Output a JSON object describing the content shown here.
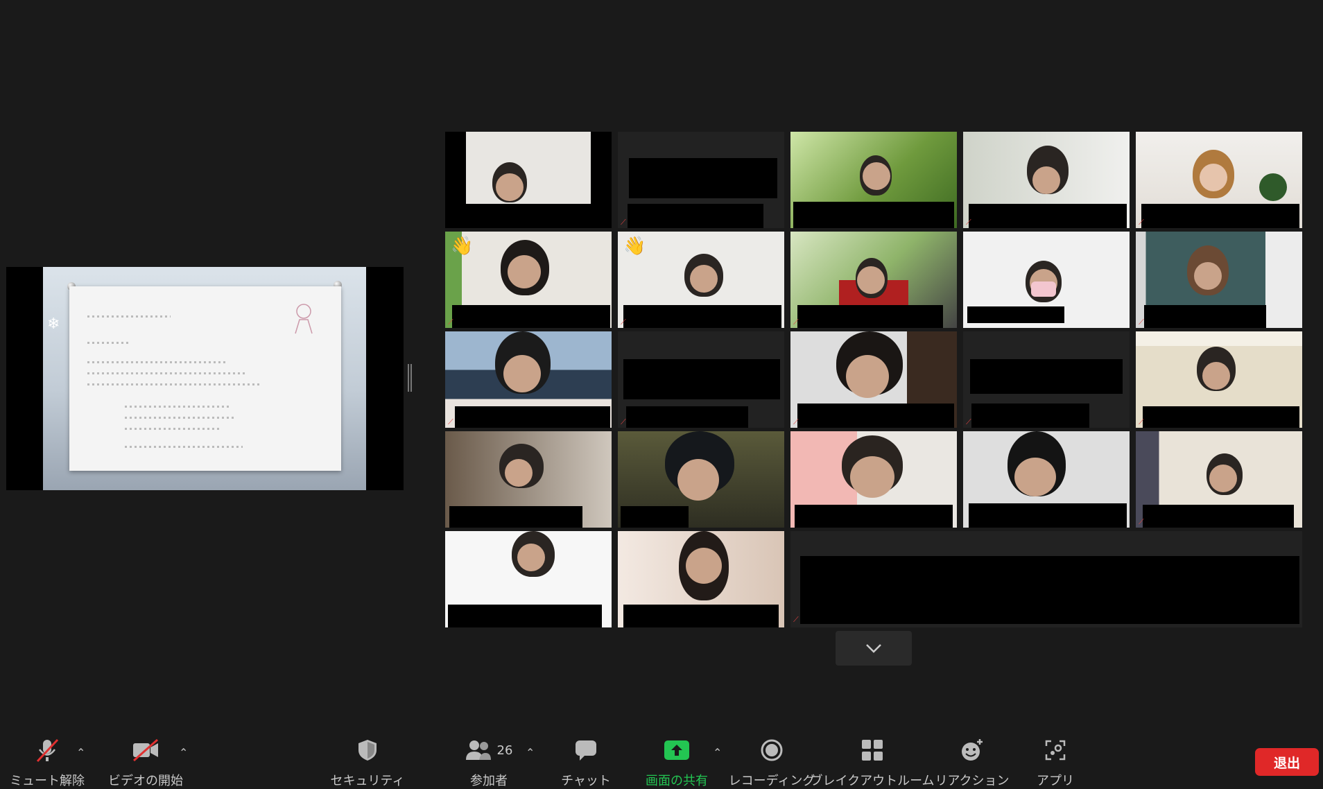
{
  "toolbar": {
    "mute_label": "ミュート解除",
    "video_label": "ビデオの開始",
    "security_label": "セキュリティ",
    "participants_label": "参加者",
    "participants_count": "26",
    "chat_label": "チャット",
    "share_label": "画面の共有",
    "record_label": "レコーディング",
    "breakout_label": "ブレイクアウトルーム",
    "reactions_label": "リアクション",
    "apps_label": "アプリ",
    "leave_label": "退出"
  },
  "icons": {
    "mute": "microphone-muted-icon",
    "video": "camera-off-icon",
    "security": "shield-icon",
    "participants": "people-icon",
    "chat": "chat-bubble-icon",
    "share": "share-arrow-icon",
    "record": "record-icon",
    "breakout": "grid-icon",
    "reactions": "emoji-add-icon",
    "apps": "apps-icon",
    "scroll": "chevron-down-icon"
  },
  "colors": {
    "background": "#1a1a1a",
    "leave_button": "#e02828",
    "share_accent": "#23c552",
    "active_speaker": "#c9e36b",
    "muted_mic": "#e04040"
  },
  "gallery": {
    "tile_count": 22,
    "active_speaker_tile": 9,
    "raised_hand_tiles": [
      6,
      7
    ]
  }
}
